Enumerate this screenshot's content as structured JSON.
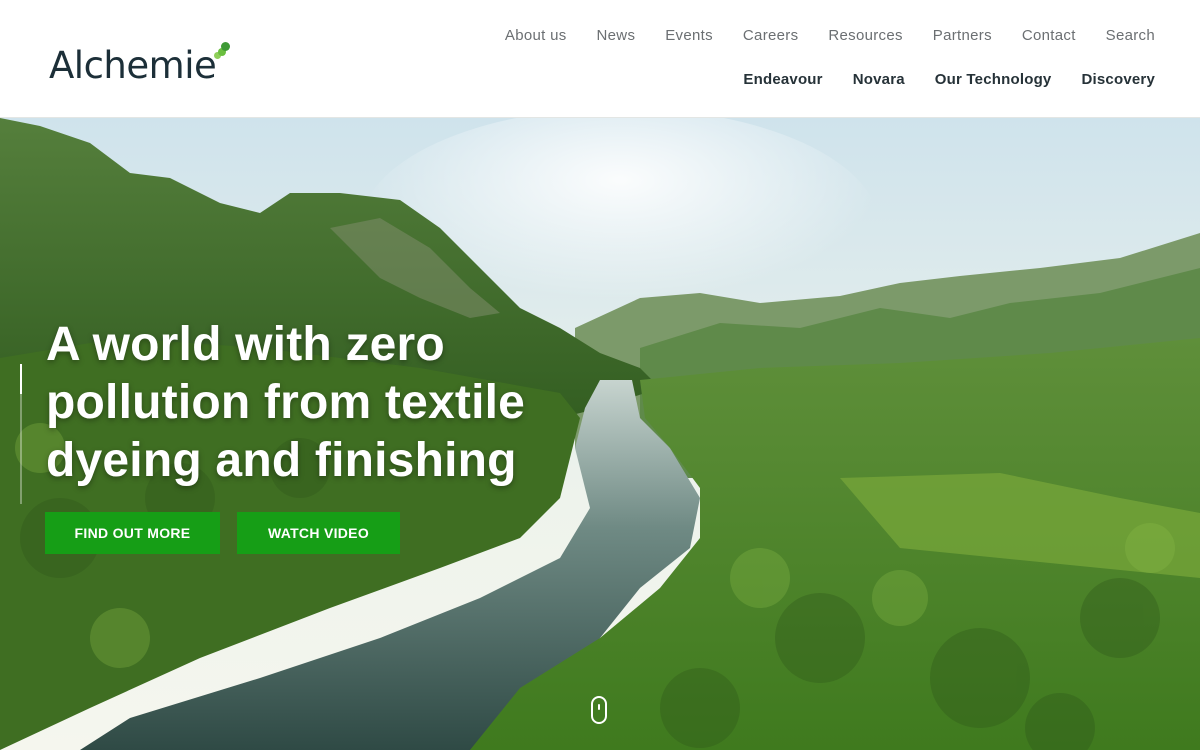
{
  "logo": {
    "text": "Alchemie",
    "accent_colors": [
      "#3f9a36",
      "#6abf3f",
      "#8fcf5a"
    ]
  },
  "nav_top": [
    "About us",
    "News",
    "Events",
    "Careers",
    "Resources",
    "Partners",
    "Contact",
    "Search"
  ],
  "nav_main": [
    "Endeavour",
    "Novara",
    "Our Technology",
    "Discovery"
  ],
  "hero": {
    "title": "A world with zero pollution from textile dyeing and finishing",
    "buttons": {
      "find_out_more": "FIND OUT MORE",
      "watch_video": "WATCH VIDEO"
    },
    "background": "aerial-river-forest-photo"
  },
  "colors": {
    "primary_green": "#169e16",
    "logo_text": "#1c2f38",
    "nav_muted": "#6b6f72",
    "nav_bold": "#263238"
  },
  "icons": {
    "scroll": "mouse-scroll-icon"
  }
}
